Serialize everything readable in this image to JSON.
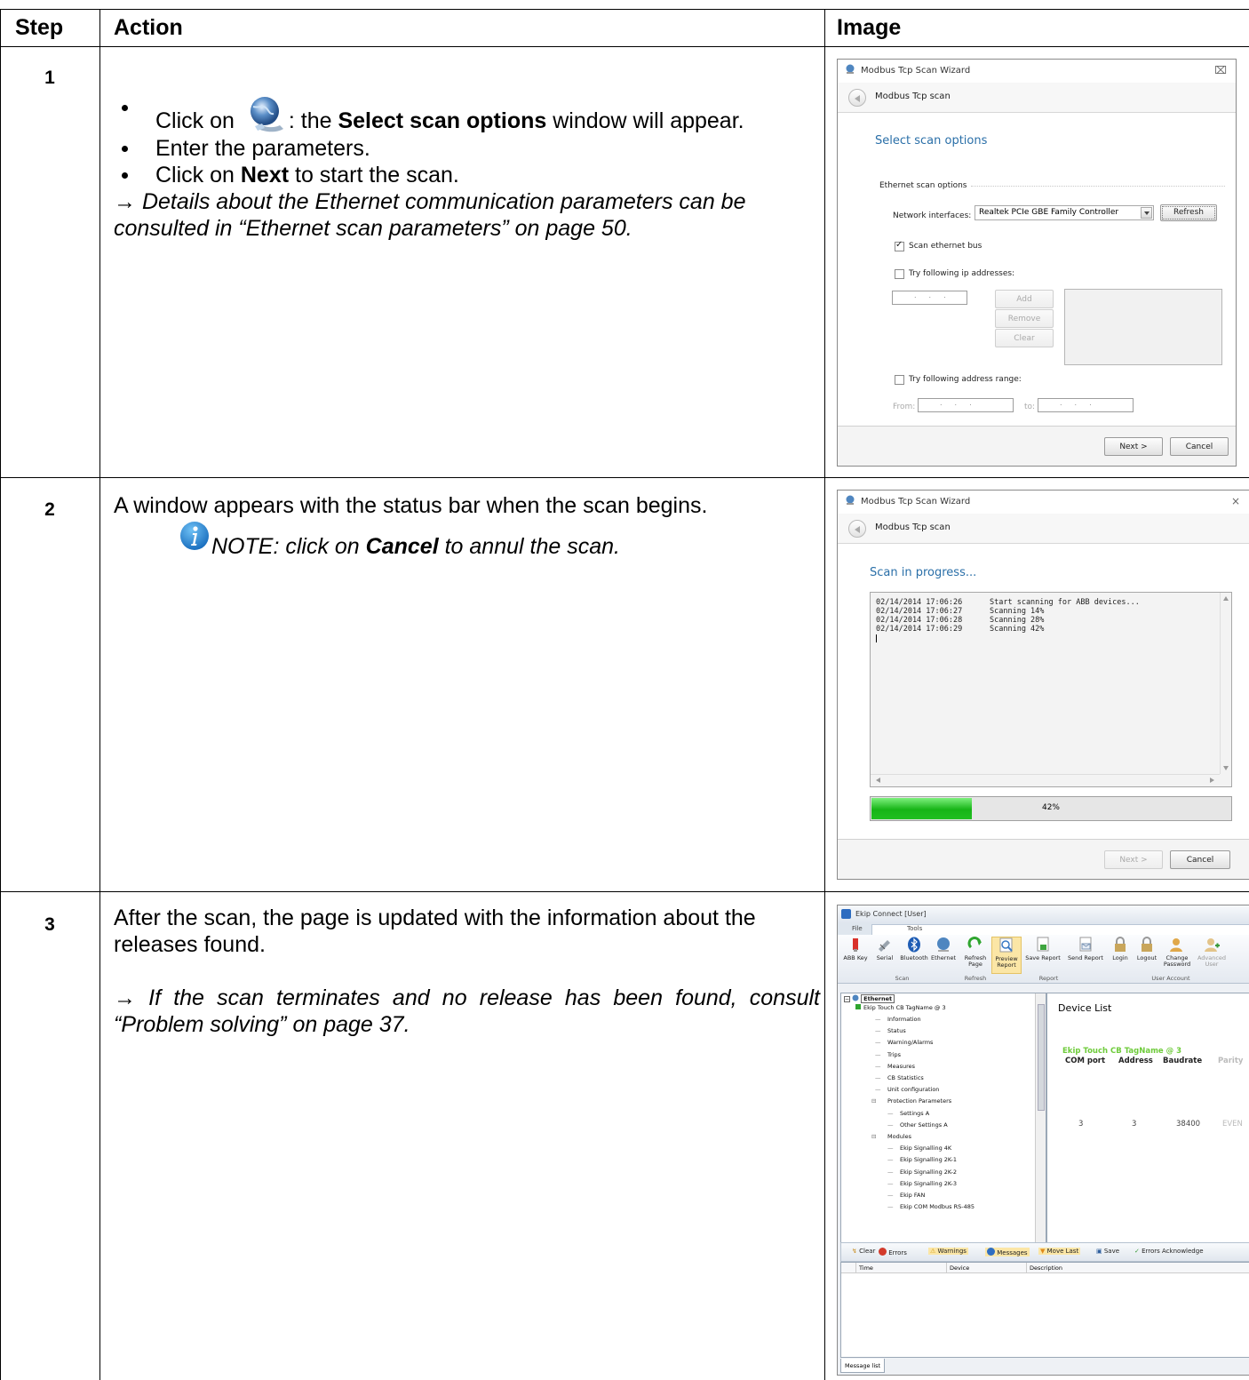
{
  "table": {
    "headers": {
      "step": "Step",
      "action": "Action",
      "image": "Image"
    },
    "rows": [
      {
        "step": "1",
        "bullets": [
          {
            "pre": "Click on",
            "mid": ": the ",
            "bold": "Select scan options",
            "post": " window will appear."
          },
          {
            "text": "Enter the parameters."
          },
          {
            "pre": "Click on ",
            "bold": "Next",
            "post": " to start the scan."
          }
        ],
        "note": "→ Details about the Ethernet communication parameters can be consulted in “Ethernet scan parameters” on page 50."
      },
      {
        "step": "2",
        "text": "A window appears with the status bar when the scan begins.",
        "note_pre": "NOTE: click on ",
        "note_bold": "Cancel",
        "note_post": " to annul the scan."
      },
      {
        "step": "3",
        "text": "After the scan, the page is updated with the information about the releases found.",
        "note": "→ If the scan terminates and no release has been found, consult “Problem solving” on page 37."
      }
    ]
  },
  "win1": {
    "title": "Modbus Tcp Scan Wizard",
    "close": "⌧",
    "band": "Modbus Tcp scan",
    "heading": "Select scan options",
    "section": "Ethernet scan options",
    "ni_label": "Network interfaces:",
    "ni_value": "Realtek PCIe GBE Family Controller",
    "refresh": "Refresh",
    "scan_bus": "Scan ethernet bus",
    "try_ip": "Try following ip addresses:",
    "add": "Add",
    "remove": "Remove",
    "clear": "Clear",
    "try_range": "Try following address range:",
    "from": "From:",
    "to": "to:",
    "ip_dots": "...",
    "next": "Next >",
    "cancel": "Cancel"
  },
  "win2": {
    "title": "Modbus Tcp Scan Wizard",
    "close": "×",
    "band": "Modbus Tcp scan",
    "heading": "Scan in progress...",
    "log": [
      {
        "time": "02/14/2014 17:06:26",
        "msg": "Start scanning for ABB devices..."
      },
      {
        "time": "02/14/2014 17:06:27",
        "msg": "Scanning 14%"
      },
      {
        "time": "02/14/2014 17:06:28",
        "msg": "Scanning 28%"
      },
      {
        "time": "02/14/2014 17:06:29",
        "msg": "Scanning 42%"
      }
    ],
    "progress_label": "42%",
    "progress_value": 0.42,
    "next": "Next >",
    "cancel": "Cancel"
  },
  "win3": {
    "title": "Ekip Connect [User]",
    "tabs": [
      "File",
      "Home",
      "Tools"
    ],
    "ribbon": {
      "abbkey": "ABB Key",
      "serial": "Serial",
      "bluetooth": "Bluetooth",
      "ethernet": "Ethernet",
      "refresh": "Refresh Page",
      "preview": "Preview Report",
      "save_report": "Save Report",
      "send_report": "Send Report",
      "login": "Login",
      "logout": "Logout",
      "change_pw": "Change Password",
      "adv_user": "Advanced User",
      "g_scan": "Scan",
      "g_refresh": "Refresh",
      "g_report": "Report",
      "g_user": "User Account"
    },
    "tree": {
      "root": "Ethernet",
      "device": "Ekip Touch CB TagName @ 3",
      "items": [
        "Information",
        "Status",
        "Warning/Alarms",
        "Trips",
        "Measures",
        "CB Statistics",
        "Unit configuration"
      ],
      "prot": "Protection Parameters",
      "prot_items": [
        "Settings A",
        "Other Settings A"
      ],
      "modules": "Modules",
      "module_items": [
        "Ekip Signalling 4K",
        "Ekip Signalling 2K-1",
        "Ekip Signalling 2K-2",
        "Ekip Signalling 2K-3",
        "Ekip FAN",
        "Ekip COM Modbus RS-485"
      ]
    },
    "device_list": {
      "title": "Device List",
      "device": "Ekip Touch CB TagName @ 3",
      "cols": [
        "COM port",
        "Address",
        "Baudrate",
        "Parity"
      ],
      "vals": [
        "3",
        "3",
        "38400",
        "EVEN"
      ]
    },
    "msgbar": {
      "clear": "Clear",
      "errors": "Errors",
      "warnings": "Warnings",
      "messages": "Messages",
      "move_last": "Move Last",
      "save": "Save",
      "errors_ack": "Errors Acknowledge"
    },
    "grid_cols": [
      "Time",
      "Device",
      "Description"
    ],
    "bottom_tab": "Message list"
  }
}
